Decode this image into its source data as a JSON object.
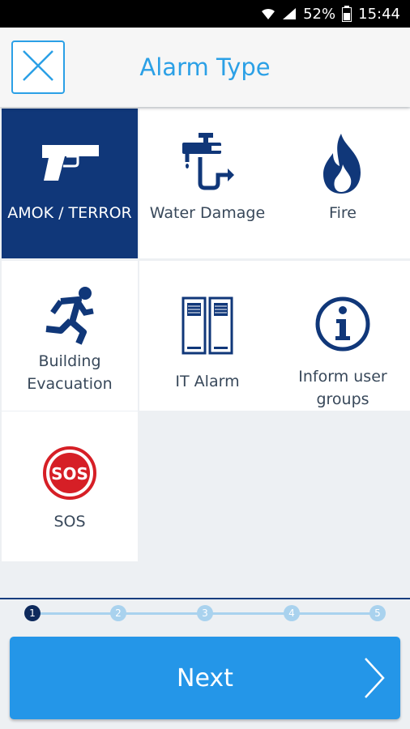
{
  "status_bar": {
    "battery": "52%",
    "time": "15:44",
    "icons": [
      "wifi-icon",
      "signal-icon",
      "battery-icon"
    ]
  },
  "header": {
    "title": "Alarm Type",
    "close_icon": "close-icon"
  },
  "alarm_types": [
    {
      "label": "AMOK / TERROR",
      "icon": "gun-icon",
      "selected": true
    },
    {
      "label": "Water Damage",
      "icon": "faucet-icon",
      "selected": false
    },
    {
      "label": "Fire",
      "icon": "fire-icon",
      "selected": false
    },
    {
      "label": "Building\nEvacuation",
      "icon": "running-person-icon",
      "selected": false
    },
    {
      "label": "IT Alarm",
      "icon": "server-icon",
      "selected": false
    },
    {
      "label": "Inform user groups",
      "icon": "info-icon",
      "selected": false
    },
    {
      "label": "SOS",
      "icon": "sos-icon",
      "selected": false
    }
  ],
  "stepper": {
    "steps": [
      "1",
      "2",
      "3",
      "4",
      "5"
    ],
    "current": 1
  },
  "next_button": {
    "label": "Next"
  },
  "colors": {
    "accent": "#2ba0e6",
    "selected_bg": "#103779",
    "icon_blue": "#103779",
    "sos_red": "#d61f26",
    "button": "#2496e8"
  }
}
